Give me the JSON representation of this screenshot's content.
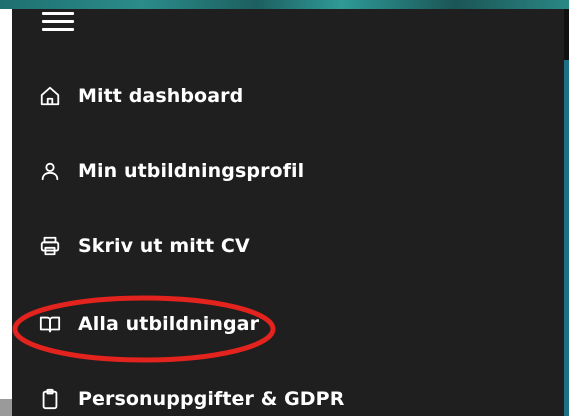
{
  "menu": {
    "toggle_icon": "hamburger-menu-icon",
    "items": [
      {
        "label": "Mitt dashboard",
        "icon": "home-icon"
      },
      {
        "label": "Min utbildningsprofil",
        "icon": "user-icon"
      },
      {
        "label": "Skriv ut mitt CV",
        "icon": "printer-icon"
      },
      {
        "label": "Alla utbildningar",
        "icon": "open-book-icon"
      },
      {
        "label": "Personuppgifter & GDPR",
        "icon": "clipboard-icon"
      }
    ]
  },
  "annotation": {
    "highlighted_item": "Alla utbildningar",
    "color": "#e3231d"
  },
  "colors": {
    "panel_background": "#1f1f1f",
    "text": "#ffffff",
    "accent": "#1d6f82"
  }
}
